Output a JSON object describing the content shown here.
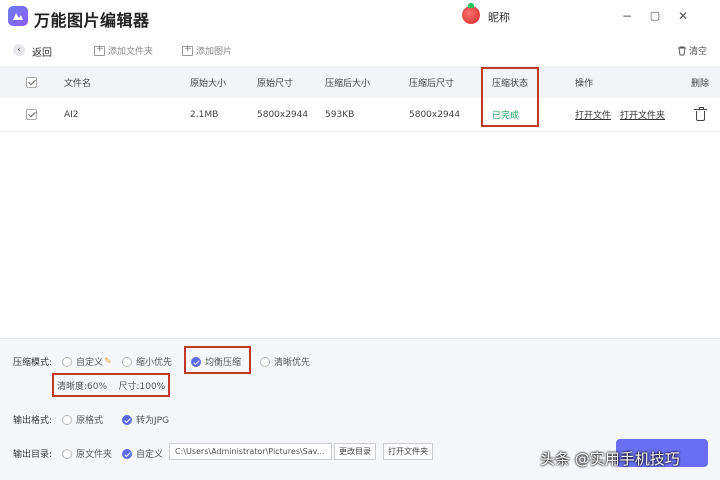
{
  "titlebar": {
    "app_title": "万能图片编辑器",
    "nickname": "昵称",
    "minimize": "−",
    "restore": "▢",
    "close": "✕"
  },
  "toolbar": {
    "back": "返回",
    "add_folder": "添加文件夹",
    "add_image": "添加图片",
    "clear": "清空"
  },
  "table": {
    "headers": {
      "name": "文件名",
      "orig_size": "原始大小",
      "orig_dim": "原始尺寸",
      "comp_size": "压缩后大小",
      "comp_dim": "压缩后尺寸",
      "status": "压缩状态",
      "actions": "操作",
      "delete": "删除"
    },
    "rows": [
      {
        "name": "AI2",
        "orig_size": "2.1MB",
        "orig_dim": "5800x2944",
        "comp_size": "593KB",
        "comp_dim": "5800x2944",
        "status": "已完成",
        "open_file": "打开文件",
        "open_folder": "打开文件夹"
      }
    ]
  },
  "settings": {
    "mode_label": "压缩模式:",
    "modes": [
      "自定义",
      "缩小优先",
      "均衡压缩",
      "清晰优先"
    ],
    "selected_mode": "均衡压缩",
    "quality_text": "清晰度:60%    尺寸:100%",
    "format_label": "输出格式:",
    "formats": [
      "原格式",
      "转为JPG"
    ],
    "selected_format": "转为JPG",
    "dir_label": "输出目录:",
    "dirs": [
      "原文件夹",
      "自定义"
    ],
    "selected_dir": "自定义",
    "path": "C:\\Users\\Administrator\\Pictures\\Sav...",
    "change_dir": "更改目录",
    "open_folder": "打开文件夹"
  },
  "watermark": "头条 @实用手机技巧",
  "colors": {
    "accent": "#5b6cf0",
    "status_done": "#22a060",
    "highlight_box": "#c0392b"
  }
}
